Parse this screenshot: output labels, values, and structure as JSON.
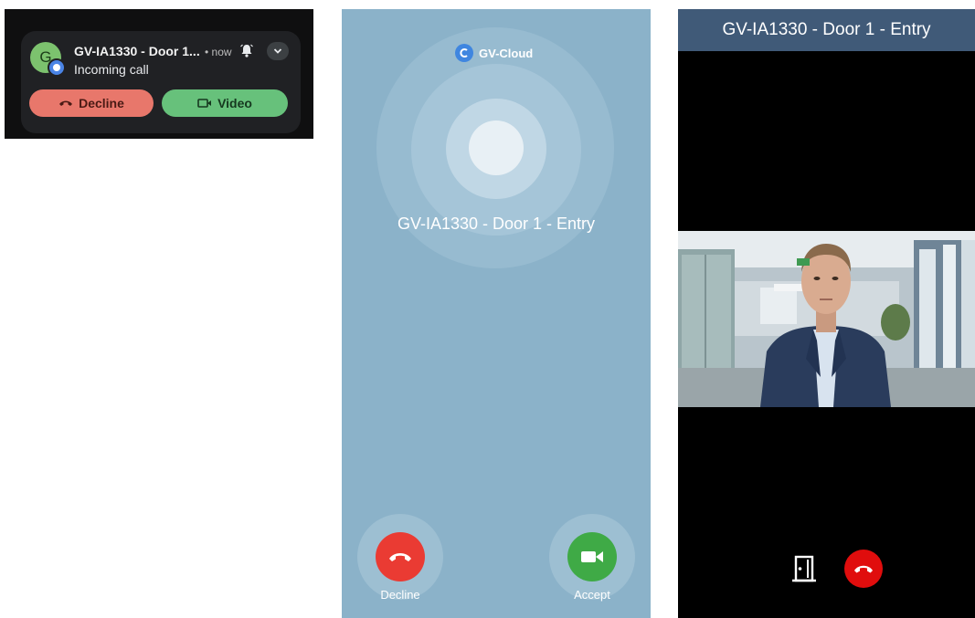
{
  "notification": {
    "title": "GV-IA1330 - Door 1...",
    "time": "• now",
    "subtitle": "Incoming call",
    "avatar_letter": "G",
    "decline_label": "Decline",
    "video_label": "Video",
    "icons": [
      "app-avatar",
      "gv-cloud-badge",
      "alarm-bell-icon",
      "chevron-down-icon",
      "phone-hangup-icon",
      "video-camera-icon"
    ]
  },
  "incoming_call": {
    "app_name": "GV-Cloud",
    "caller": "GV-IA1330 - Door 1 - Entry",
    "decline_label": "Decline",
    "accept_label": "Accept",
    "icons": [
      "gv-cloud-logo",
      "phone-hangup-icon",
      "video-camera-icon"
    ],
    "colors": {
      "background": "#8bb2c9",
      "decline": "#ea3b33",
      "accept": "#3faa46"
    }
  },
  "video_call": {
    "header_title": "GV-IA1330 - Door 1 - Entry",
    "icons": [
      "door-unlock-icon",
      "phone-hangup-icon"
    ],
    "colors": {
      "header": "#405a78",
      "hangup": "#e00d0d"
    }
  }
}
